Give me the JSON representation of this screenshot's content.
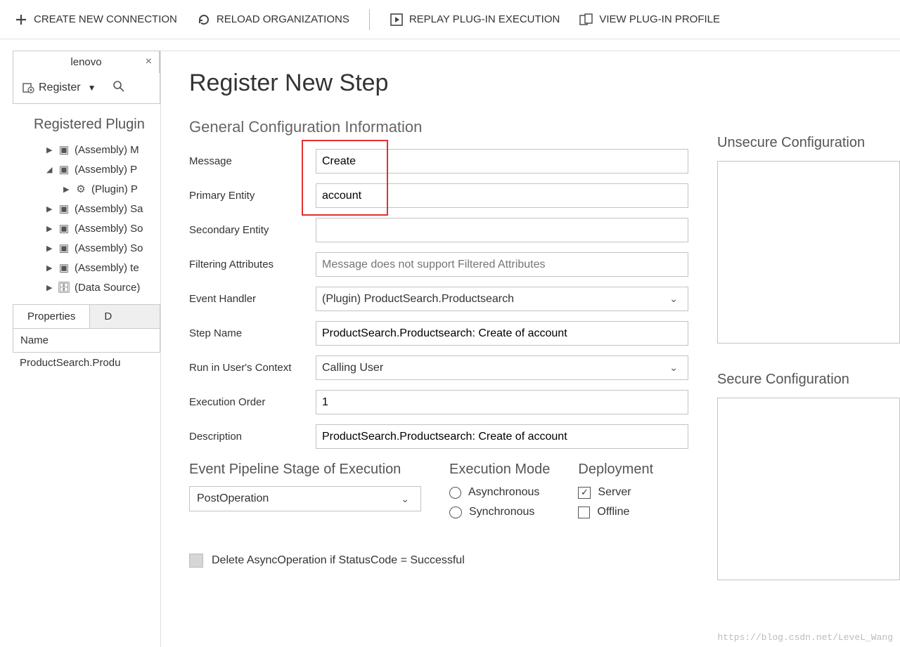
{
  "toolbar": {
    "create": "CREATE NEW CONNECTION",
    "reload": "RELOAD ORGANIZATIONS",
    "replay": "REPLAY PLUG-IN EXECUTION",
    "view": "VIEW PLUG-IN PROFILE"
  },
  "tabs": {
    "active": "lenovo"
  },
  "registerBtn": "Register",
  "treeHeader": "Registered Plugin",
  "tree": [
    {
      "label": "(Assembly) M",
      "type": "asm"
    },
    {
      "label": "(Assembly) P",
      "type": "asm",
      "expanded": true,
      "children": [
        {
          "label": "(Plugin) P",
          "type": "plugin"
        }
      ]
    },
    {
      "label": "(Assembly) Sa",
      "type": "asm"
    },
    {
      "label": "(Assembly) So",
      "type": "asm"
    },
    {
      "label": "(Assembly) So",
      "type": "asm"
    },
    {
      "label": "(Assembly) te",
      "type": "asm"
    },
    {
      "label": "(Data Source)",
      "type": "ds"
    }
  ],
  "propsTabs": {
    "active": "Properties",
    "other": "D"
  },
  "grid": {
    "header": "Name",
    "row": "ProductSearch.Produ"
  },
  "form": {
    "title": "Register New Step",
    "section": "General Configuration Information",
    "labels": {
      "message": "Message",
      "primary": "Primary Entity",
      "secondary": "Secondary Entity",
      "filtering": "Filtering Attributes",
      "handler": "Event Handler",
      "step": "Step Name",
      "runctx": "Run in User's Context",
      "order": "Execution Order",
      "desc": "Description"
    },
    "values": {
      "message": "Create",
      "primary": "account",
      "secondary": "",
      "filtering_ph": "Message does not support Filtered Attributes",
      "handler": "(Plugin) ProductSearch.Productsearch",
      "step": "ProductSearch.Productsearch: Create of account",
      "runctx": "Calling User",
      "order": "1",
      "desc": "ProductSearch.Productsearch: Create of account"
    },
    "pipeline": {
      "title": "Event Pipeline Stage of Execution",
      "value": "PostOperation"
    },
    "execMode": {
      "title": "Execution Mode",
      "async": "Asynchronous",
      "sync": "Synchronous",
      "selected": "sync"
    },
    "deploy": {
      "title": "Deployment",
      "server": "Server",
      "offline": "Offline",
      "serverChecked": true,
      "offlineChecked": false
    },
    "deleteAsync": "Delete AsyncOperation if StatusCode = Successful"
  },
  "right": {
    "unsecure": "Unsecure  Configuration",
    "secure": "Secure  Configuration"
  },
  "watermark": "https://blog.csdn.net/LeveL_Wang"
}
